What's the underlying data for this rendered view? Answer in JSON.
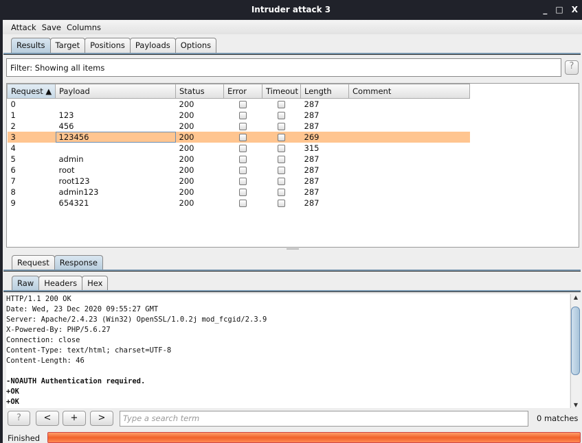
{
  "window": {
    "title": "Intruder attack 3",
    "controls": {
      "minimize": "_",
      "maximize": "□",
      "close": "X"
    }
  },
  "menu": [
    "Attack",
    "Save",
    "Columns"
  ],
  "main_tabs": [
    {
      "label": "Results",
      "selected": true
    },
    {
      "label": "Target"
    },
    {
      "label": "Positions"
    },
    {
      "label": "Payloads"
    },
    {
      "label": "Options"
    }
  ],
  "filter": {
    "text": "Filter: Showing all items",
    "help": "?"
  },
  "table": {
    "columns": [
      "Request ▲",
      "Payload",
      "Status",
      "Error",
      "Timeout",
      "Length",
      "Comment"
    ],
    "rows": [
      {
        "request": "0",
        "payload": "",
        "status": "200",
        "error": false,
        "timeout": false,
        "length": "287",
        "comment": ""
      },
      {
        "request": "1",
        "payload": "123",
        "status": "200",
        "error": false,
        "timeout": false,
        "length": "287",
        "comment": ""
      },
      {
        "request": "2",
        "payload": "456",
        "status": "200",
        "error": false,
        "timeout": false,
        "length": "287",
        "comment": ""
      },
      {
        "request": "3",
        "payload": "123456",
        "status": "200",
        "error": false,
        "timeout": false,
        "length": "269",
        "comment": "",
        "selected": true
      },
      {
        "request": "4",
        "payload": "",
        "status": "200",
        "error": false,
        "timeout": false,
        "length": "315",
        "comment": ""
      },
      {
        "request": "5",
        "payload": "admin",
        "status": "200",
        "error": false,
        "timeout": false,
        "length": "287",
        "comment": ""
      },
      {
        "request": "6",
        "payload": "root",
        "status": "200",
        "error": false,
        "timeout": false,
        "length": "287",
        "comment": ""
      },
      {
        "request": "7",
        "payload": "root123",
        "status": "200",
        "error": false,
        "timeout": false,
        "length": "287",
        "comment": ""
      },
      {
        "request": "8",
        "payload": "admin123",
        "status": "200",
        "error": false,
        "timeout": false,
        "length": "287",
        "comment": ""
      },
      {
        "request": "9",
        "payload": "654321",
        "status": "200",
        "error": false,
        "timeout": false,
        "length": "287",
        "comment": ""
      }
    ]
  },
  "rr_tabs": [
    {
      "label": "Request"
    },
    {
      "label": "Response",
      "selected": true
    }
  ],
  "view_tabs": [
    {
      "label": "Raw",
      "selected": true
    },
    {
      "label": "Headers"
    },
    {
      "label": "Hex"
    }
  ],
  "response_lines": [
    {
      "text": "HTTP/1.1 200 OK"
    },
    {
      "text": "Date: Wed, 23 Dec 2020 09:55:27 GMT"
    },
    {
      "text": "Server: Apache/2.4.23 (Win32) OpenSSL/1.0.2j mod_fcgid/2.3.9"
    },
    {
      "text": "X-Powered-By: PHP/5.6.27"
    },
    {
      "text": "Connection: close"
    },
    {
      "text": "Content-Type: text/html; charset=UTF-8"
    },
    {
      "text": "Content-Length: 46"
    },
    {
      "text": ""
    },
    {
      "text": "-NOAUTH Authentication required.",
      "bold": true
    },
    {
      "text": "+OK",
      "bold": true
    },
    {
      "text": "+OK",
      "bold": true
    }
  ],
  "search": {
    "help": "?",
    "prev": "<",
    "add": "+",
    "next": ">",
    "placeholder": "Type a search term",
    "matches": "0 matches"
  },
  "status": {
    "text": "Finished",
    "progress": 100,
    "progress_color": "#f0622c"
  }
}
